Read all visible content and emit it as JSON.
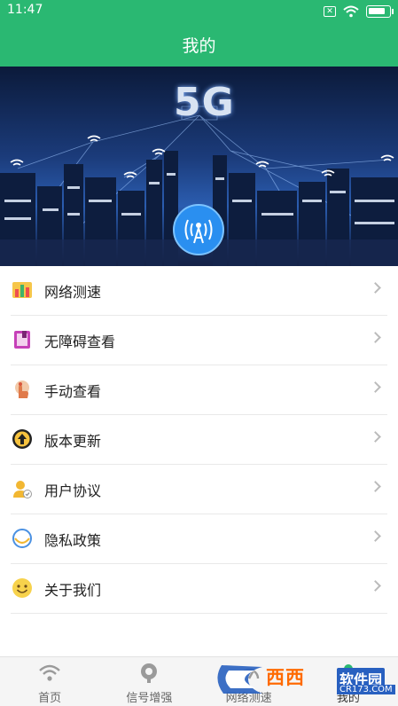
{
  "status_bar": {
    "time": "11:47"
  },
  "header": {
    "title": "我的"
  },
  "banner": {
    "label": "5G"
  },
  "menu": [
    {
      "label": "网络测速",
      "icon": "chart-icon"
    },
    {
      "label": "无障碍查看",
      "icon": "book-icon"
    },
    {
      "label": "手动查看",
      "icon": "hand-icon"
    },
    {
      "label": "版本更新",
      "icon": "upgrade-icon"
    },
    {
      "label": "用户协议",
      "icon": "user-icon"
    },
    {
      "label": "隐私政策",
      "icon": "privacy-icon"
    },
    {
      "label": "关于我们",
      "icon": "smile-icon"
    }
  ],
  "tabs": [
    {
      "label": "首页",
      "icon": "wifi-icon"
    },
    {
      "label": "信号增强",
      "icon": "signal-boost-icon"
    },
    {
      "label": "网络测速",
      "icon": "speed-icon"
    },
    {
      "label": "我的",
      "icon": "profile-icon",
      "active": true
    }
  ],
  "watermark": {
    "text": "西西",
    "sub": "软件园",
    "url": "CR173.COM"
  },
  "colors": {
    "primary": "#2ab872",
    "divider": "#e9e9e9",
    "tabbar": "#f5f5f5"
  }
}
